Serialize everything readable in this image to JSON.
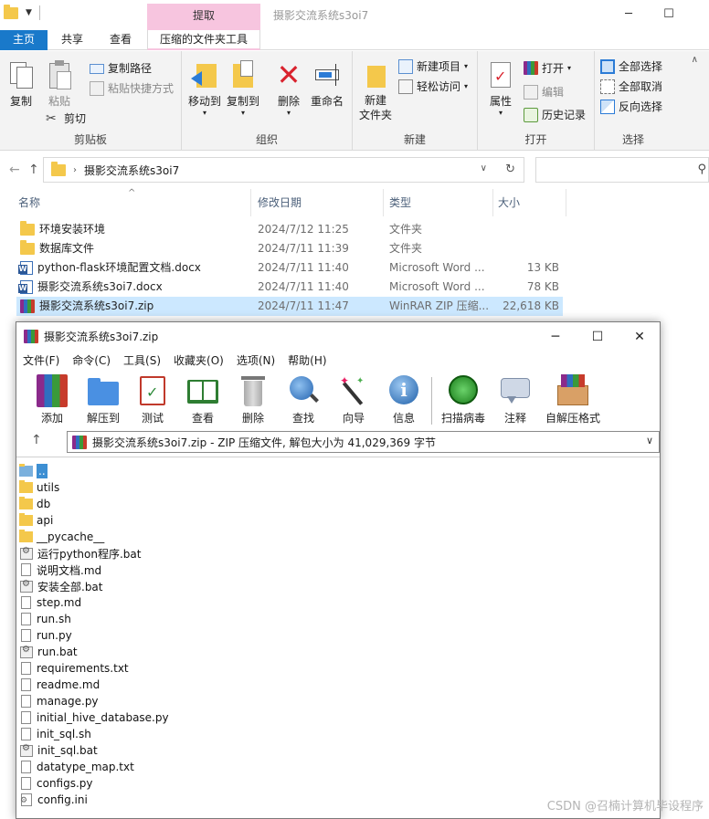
{
  "explorer": {
    "window_title": "摄影交流系统s3oi7",
    "context_tab_header": "提取",
    "tabs": [
      {
        "label": "主页"
      },
      {
        "label": "共享"
      },
      {
        "label": "查看"
      },
      {
        "label": "压缩的文件夹工具"
      }
    ],
    "ribbon": {
      "clipboard": {
        "label": "剪贴板",
        "copy": "复制",
        "paste": "粘贴",
        "copy_path": "复制路径",
        "paste_shortcut": "粘贴快捷方式",
        "cut": "剪切"
      },
      "organize": {
        "label": "组织",
        "move_to": "移动到",
        "copy_to": "复制到",
        "delete": "删除",
        "rename": "重命名"
      },
      "new": {
        "label": "新建",
        "new_folder": "新建\n文件夹",
        "new_item": "新建项目",
        "easy_access": "轻松访问"
      },
      "open": {
        "label": "打开",
        "properties": "属性",
        "open": "打开",
        "edit": "编辑",
        "history": "历史记录"
      },
      "select": {
        "label": "选择",
        "select_all": "全部选择",
        "select_none": "全部取消",
        "invert": "反向选择"
      }
    },
    "address": {
      "path": "摄影交流系统s3oi7"
    },
    "columns": {
      "name": "名称",
      "date": "修改日期",
      "type": "类型",
      "size": "大小"
    },
    "files": [
      {
        "name": "环境安装环境",
        "date": "2024/7/12 11:25",
        "type": "文件夹",
        "size": "",
        "icon": "folder-icon"
      },
      {
        "name": "数据库文件",
        "date": "2024/7/11 11:39",
        "type": "文件夹",
        "size": "",
        "icon": "folder-icon"
      },
      {
        "name": "python-flask环境配置文档.docx",
        "date": "2024/7/11 11:40",
        "type": "Microsoft Word ...",
        "size": "13 KB",
        "icon": "word-icon"
      },
      {
        "name": "摄影交流系统s3oi7.docx",
        "date": "2024/7/11 11:40",
        "type": "Microsoft Word ...",
        "size": "78 KB",
        "icon": "word-icon"
      },
      {
        "name": "摄影交流系统s3oi7.zip",
        "date": "2024/7/11 11:47",
        "type": "WinRAR ZIP 压缩...",
        "size": "22,618 KB",
        "icon": "winrar-icon",
        "selected": true
      }
    ]
  },
  "winrar": {
    "title": "摄影交流系统s3oi7.zip",
    "menu": [
      "文件(F)",
      "命令(C)",
      "工具(S)",
      "收藏夹(O)",
      "选项(N)",
      "帮助(H)"
    ],
    "toolbar": [
      {
        "label": "添加",
        "icon": "add-archive-icon"
      },
      {
        "label": "解压到",
        "icon": "extract-folder-icon"
      },
      {
        "label": "测试",
        "icon": "test-clipboard-icon"
      },
      {
        "label": "查看",
        "icon": "view-book-icon"
      },
      {
        "label": "删除",
        "icon": "trash-icon"
      },
      {
        "label": "查找",
        "icon": "magnifier-icon"
      },
      {
        "label": "向导",
        "icon": "wizard-wand-icon"
      },
      {
        "label": "信息",
        "icon": "info-icon"
      },
      {
        "label": "扫描病毒",
        "icon": "virus-scan-icon"
      },
      {
        "label": "注释",
        "icon": "comment-icon"
      },
      {
        "label": "自解压格式",
        "icon": "sfx-box-icon"
      }
    ],
    "path_info": "摄影交流系统s3oi7.zip - ZIP 压缩文件, 解包大小为 41,029,369 字节",
    "entries": [
      {
        "name": "..",
        "kind": "up"
      },
      {
        "name": "utils",
        "kind": "folder"
      },
      {
        "name": "db",
        "kind": "folder"
      },
      {
        "name": "api",
        "kind": "folder"
      },
      {
        "name": "__pycache__",
        "kind": "folder"
      },
      {
        "name": "运行python程序.bat",
        "kind": "bat"
      },
      {
        "name": "说明文档.md",
        "kind": "doc"
      },
      {
        "name": "安装全部.bat",
        "kind": "bat"
      },
      {
        "name": "step.md",
        "kind": "doc"
      },
      {
        "name": "run.sh",
        "kind": "doc"
      },
      {
        "name": "run.py",
        "kind": "doc"
      },
      {
        "name": "run.bat",
        "kind": "bat"
      },
      {
        "name": "requirements.txt",
        "kind": "doc"
      },
      {
        "name": "readme.md",
        "kind": "doc"
      },
      {
        "name": "manage.py",
        "kind": "doc"
      },
      {
        "name": "initial_hive_database.py",
        "kind": "doc"
      },
      {
        "name": "init_sql.sh",
        "kind": "doc"
      },
      {
        "name": "init_sql.bat",
        "kind": "bat"
      },
      {
        "name": "datatype_map.txt",
        "kind": "doc"
      },
      {
        "name": "configs.py",
        "kind": "doc"
      },
      {
        "name": "config.ini",
        "kind": "ini"
      }
    ]
  },
  "watermark": "CSDN @召楠计算机毕设程序"
}
